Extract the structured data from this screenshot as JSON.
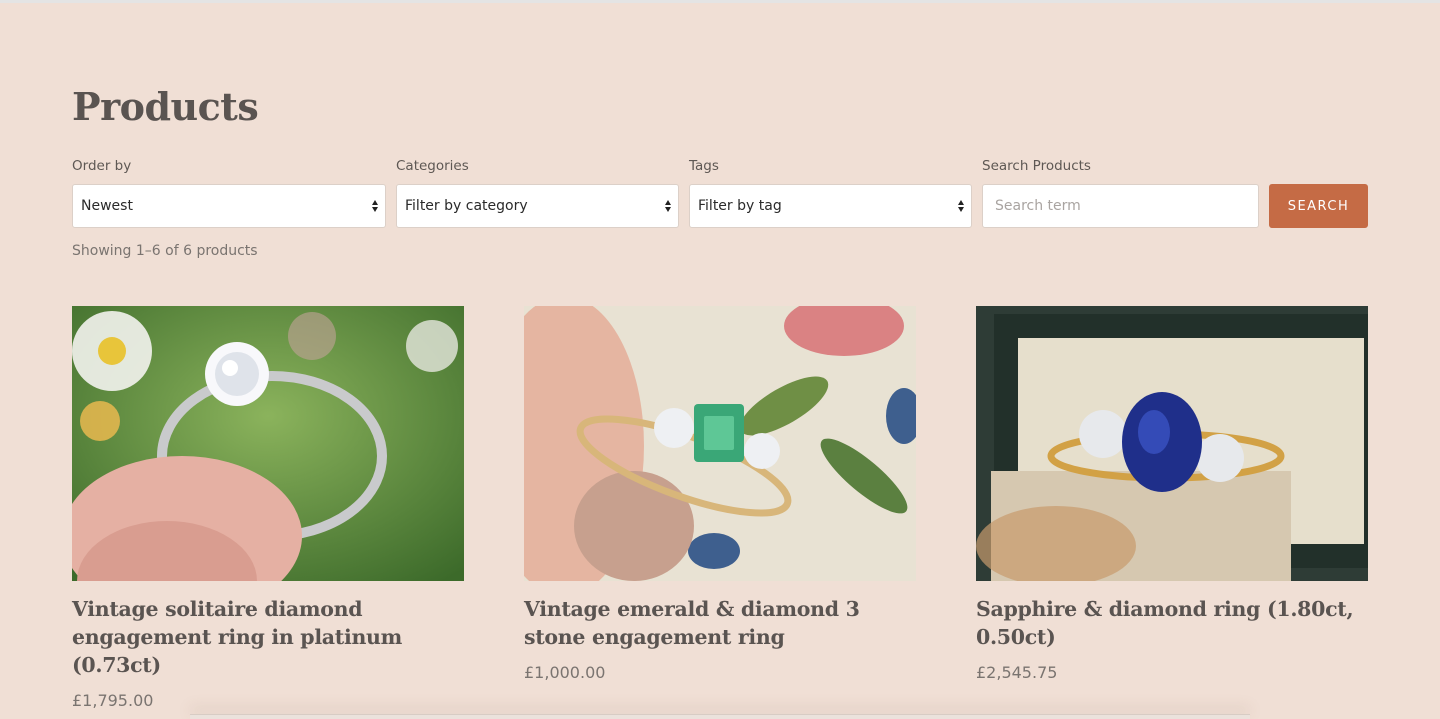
{
  "page": {
    "title": "Products"
  },
  "filters": {
    "order_by": {
      "label": "Order by",
      "value": "Newest"
    },
    "categories": {
      "label": "Categories",
      "value": "Filter by category"
    },
    "tags": {
      "label": "Tags",
      "value": "Filter by tag"
    },
    "search": {
      "label": "Search Products",
      "placeholder": "Search term",
      "button": "SEARCH"
    }
  },
  "result_count": "Showing 1–6 of 6 products",
  "colors": {
    "background": "#f0dfd5",
    "accent": "#c56b45",
    "text": "#5a5451"
  },
  "products": [
    {
      "title": "Vintage solitaire diamond engagement ring in platinum (0.73ct)",
      "price": "£1,795.00"
    },
    {
      "title": "Vintage emerald & diamond 3 stone engagement ring",
      "price": "£1,000.00"
    },
    {
      "title": "Sapphire & diamond ring (1.80ct, 0.50ct)",
      "price": "£2,545.75"
    }
  ]
}
